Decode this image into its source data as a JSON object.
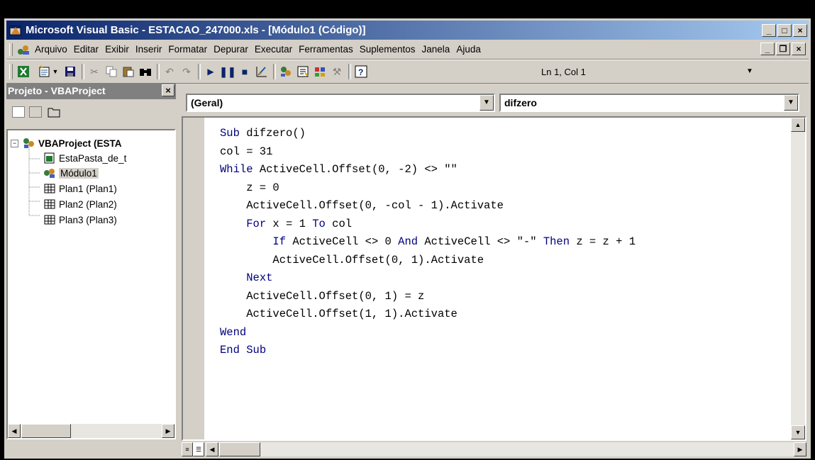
{
  "window": {
    "title": "Microsoft Visual Basic - ESTACAO_247000.xls - [Módulo1 (Código)]",
    "caption_buttons": [
      "_",
      "□",
      "×"
    ]
  },
  "menubar": {
    "items": [
      "Arquivo",
      "Editar",
      "Exibir",
      "Inserir",
      "Formatar",
      "Depurar",
      "Executar",
      "Ferramentas",
      "Suplementos",
      "Janela",
      "Ajuda"
    ],
    "mdi_buttons": [
      "_",
      "❐",
      "×"
    ]
  },
  "toolbar": {
    "icons": [
      "excel-icon",
      "insert-module-icon",
      "save-icon",
      "cut-icon",
      "copy-icon",
      "paste-icon",
      "find-icon",
      "undo-icon",
      "redo-icon",
      "run-icon",
      "break-icon",
      "reset-icon",
      "design-mode-icon",
      "project-explorer-icon",
      "properties-icon",
      "object-browser-icon",
      "toolbox-icon",
      "help-icon"
    ],
    "position": "Ln 1, Col 1"
  },
  "project": {
    "title": "Projeto - VBAProject",
    "close": "×",
    "tree": [
      {
        "label": "VBAProject (ESTA",
        "bold": true
      },
      {
        "label": "EstaPasta_de_t"
      },
      {
        "label": "Módulo1",
        "selected": true
      },
      {
        "label": "Plan1 (Plan1)"
      },
      {
        "label": "Plan2 (Plan2)"
      },
      {
        "label": "Plan3 (Plan3)"
      }
    ]
  },
  "code_window": {
    "object_combo": "(Geral)",
    "procedure_combo": "difzero",
    "lines": [
      "Sub difzero()",
      "col = 31",
      "While ActiveCell.Offset(0, -2) <> \"\"",
      "    z = 0",
      "    ActiveCell.Offset(0, -col - 1).Activate",
      "    For x = 1 To col",
      "        If ActiveCell <> 0 And ActiveCell <> \"-\" Then z = z + 1",
      "        ActiveCell.Offset(0, 1).Activate",
      "    Next",
      "    ActiveCell.Offset(0, 1) = z",
      "    ActiveCell.Offset(1, 1).Activate",
      "Wend",
      "End Sub"
    ]
  },
  "colors": {
    "titlebar_start": "#0a246a",
    "titlebar_end": "#a6caf0",
    "keyword": "#00007f",
    "face": "#d4d0c8"
  }
}
